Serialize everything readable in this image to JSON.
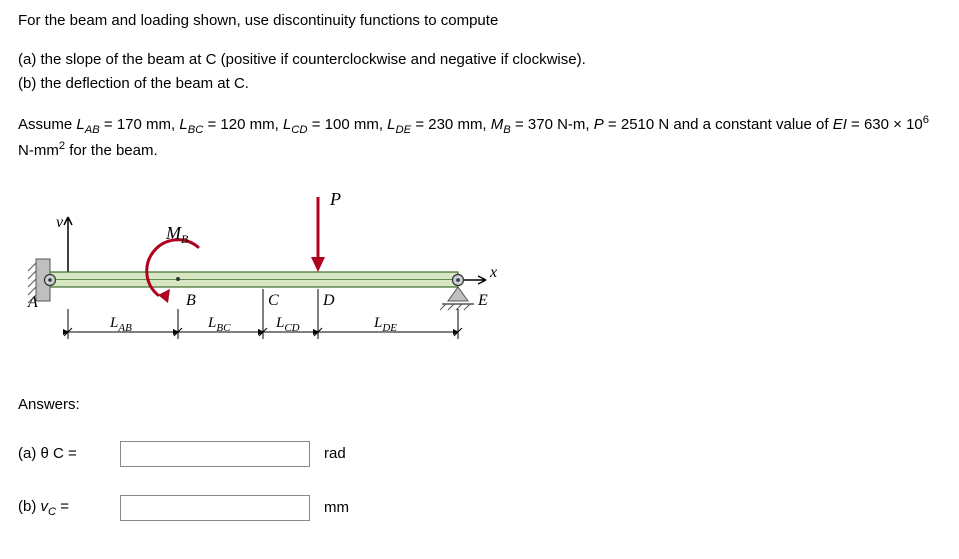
{
  "problem": {
    "intro": "For the beam and loading shown, use discontinuity functions to compute",
    "a": "(a) the slope of the beam at C (positive if counterclockwise and negative if clockwise).",
    "b": "(b) the deflection of the beam at C.",
    "assume_html": "Assume <span class=\"it\">L<span class=\"sub\">AB</span></span> = 170 mm, <span class=\"it\">L<span class=\"sub\">BC</span></span> = 120 mm, <span class=\"it\">L<span class=\"sub\">CD</span></span> = 100 mm, <span class=\"it\">L<span class=\"sub\">DE</span></span> = 230 mm, <span class=\"it\">M<span class=\"sub\">B</span></span> = 370 N-m, <span class=\"it\">P</span> = 2510 N and a constant value of <span class=\"it\">EI</span> = 630 × 10<span class=\"sup\">6</span> N-mm<span class=\"sup\">2</span> for the beam."
  },
  "figure": {
    "labels": {
      "v": "v",
      "MB": "M",
      "MB_sub": "B",
      "P": "P",
      "x": "x",
      "A": "A",
      "B": "B",
      "C": "C",
      "D": "D",
      "E": "E",
      "LAB": "L",
      "LAB_sub": "AB",
      "LBC": "L",
      "LBC_sub": "BC",
      "LCD": "L",
      "LCD_sub": "CD",
      "LDE": "L",
      "LDE_sub": "DE"
    }
  },
  "answers": {
    "header": "Answers:",
    "row_a_lbl": "(a)   θ C =",
    "row_a_unit": "rad",
    "row_b_lbl_html": "(b)   <span class=\"it\">v<span class=\"sub\">C</span></span> =",
    "row_b_unit": "mm"
  }
}
